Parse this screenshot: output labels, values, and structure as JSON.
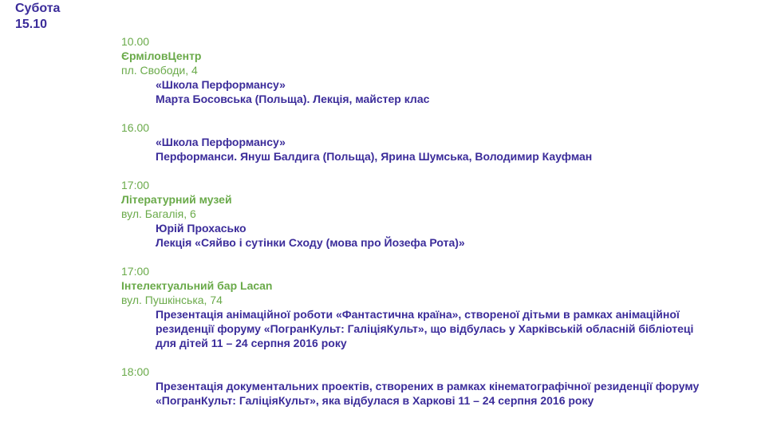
{
  "day": {
    "weekday": "Субота",
    "date": "15.10"
  },
  "events": [
    {
      "time": "10.00",
      "venue": "ЄрміловЦентр",
      "address": "пл. Свободи, 4",
      "lines": [
        "«Школа Перформансу»",
        "Марта Босовська (Польща). Лекція, майстер клас"
      ]
    },
    {
      "time": "16.00",
      "lines": [
        "«Школа Перформансу»",
        "Перформанси. Януш Балдига (Польща), Ярина Шумська, Володимир Кауфман"
      ]
    },
    {
      "time": "17:00",
      "venue": "Літературний музей",
      "address": "вул. Багалія, 6",
      "lines": [
        "Юрій Прохасько",
        "Лекція «Сяйво і сутінки Сходу (мова про Йозефа Рота)»"
      ]
    },
    {
      "time": "17:00",
      "venue": "Інтелектуальний бар Lacan",
      "address": "вул. Пушкінська, 74",
      "lines": [
        "Презентація анімаційної роботи «Фантастична країна», створеної дітьми в рамках анімаційної",
        "резиденції форуму «ПогранКульт: ГаліціяКульт», що відбулась у Харківській обласній бібліотеці",
        "для дітей 11 – 24 серпня 2016 року"
      ]
    },
    {
      "time": "18:00",
      "lines": [
        "Презентація документальних проектів, створених в рамках кінематографічної резиденції форуму",
        "«ПогранКульт: ГаліціяКульт», яка відбулася в  Харкові 11 – 24 серпня 2016 року"
      ]
    }
  ]
}
